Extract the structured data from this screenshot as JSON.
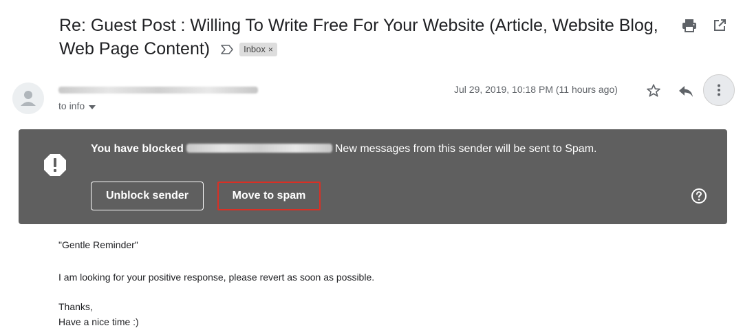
{
  "email": {
    "subject": "Re: Guest Post : Willing To Write Free For Your Website (Article, Website Blog, Web Page Content)",
    "label": "Inbox",
    "label_remove": "×",
    "recipient": "to info",
    "date": "Jul 29, 2019, 10:18 PM (11 hours ago)"
  },
  "banner": {
    "blocked_prefix": "You have blocked",
    "blocked_suffix": "New messages from this sender will be sent to Spam.",
    "unblock_label": "Unblock sender",
    "spam_label": "Move to spam",
    "highlight_color": "#d93025",
    "background_color": "#5f5f5f"
  },
  "body": {
    "line1": "\"Gentle Reminder\"",
    "line2": "I am looking for your positive response, please revert as soon as possible.",
    "line3": "Thanks,",
    "line4": "Have a nice time :)"
  },
  "icons": {
    "print": "print-icon",
    "open_new_window": "open-in-new-window-icon",
    "important": "importance-marker-icon",
    "star": "star-icon",
    "reply": "reply-icon",
    "more": "more-vertical-icon",
    "warning": "warning-icon",
    "help": "help-icon"
  }
}
